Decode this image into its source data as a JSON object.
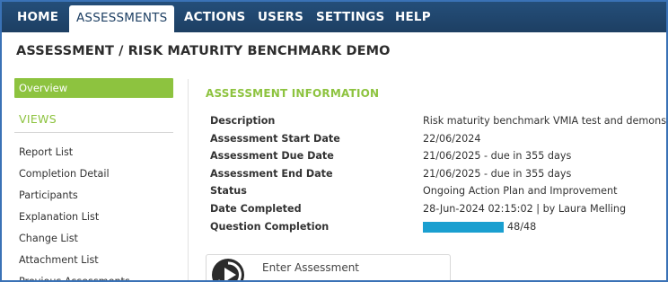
{
  "nav": {
    "items": [
      {
        "label": "HOME"
      },
      {
        "label": "ASSESSMENTS"
      },
      {
        "label": "ACTIONS"
      },
      {
        "label": "USERS"
      },
      {
        "label": "SETTINGS"
      },
      {
        "label": "HELP"
      }
    ],
    "active": "ASSESSMENTS"
  },
  "page": {
    "title": "ASSESSMENT / RISK MATURITY BENCHMARK DEMO"
  },
  "sidebar": {
    "overview_label": "Overview",
    "views_heading": "VIEWS",
    "links": [
      {
        "label": "Report List"
      },
      {
        "label": "Completion Detail"
      },
      {
        "label": "Participants"
      },
      {
        "label": "Explanation List"
      },
      {
        "label": "Change List"
      },
      {
        "label": "Attachment List"
      },
      {
        "label": "Previous Assessments"
      }
    ]
  },
  "info": {
    "heading": "ASSESSMENT INFORMATION",
    "rows": [
      {
        "label": "Description",
        "value": "Risk maturity benchmark VMIA test and demonstration"
      },
      {
        "label": "Assessment Start Date",
        "value": "22/06/2024"
      },
      {
        "label": "Assessment Due Date",
        "value": "21/06/2025 - due in 355 days"
      },
      {
        "label": "Assessment End Date",
        "value": "21/06/2025 - due in 355 days"
      },
      {
        "label": "Status",
        "value": "Ongoing Action Plan and Improvement"
      },
      {
        "label": "Date Completed",
        "value": "28-Jun-2024 02:15:02 | by Laura Melling"
      }
    ],
    "completion": {
      "label": "Question Completion",
      "text": "48/48",
      "completed": 48,
      "total": 48
    }
  },
  "enter_card": {
    "label": "Enter Assessment",
    "icon": "play-icon"
  },
  "colors": {
    "nav_bg": "#1d3f63",
    "accent_green": "#8dc33f",
    "progress_blue": "#1a9fd0",
    "frame_border": "#3a72b6"
  }
}
